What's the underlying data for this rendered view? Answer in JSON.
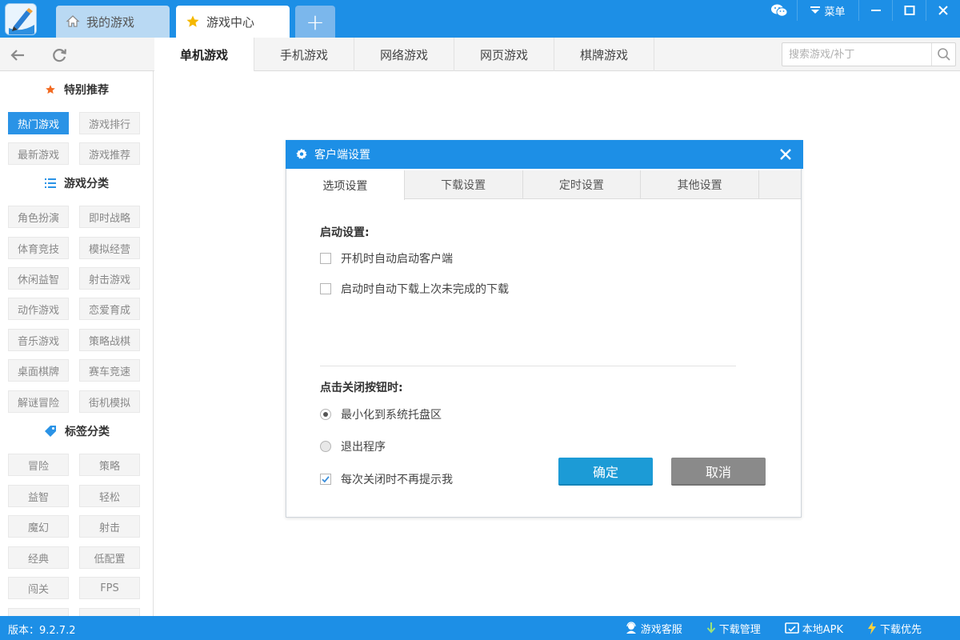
{
  "titlebar": {
    "tabs": [
      {
        "label": "我的游戏",
        "icon": "home-icon"
      },
      {
        "label": "游戏中心",
        "icon": "star-icon"
      }
    ],
    "add_tab_label": "+",
    "menu_label": "菜单"
  },
  "navbar": {
    "tabs": [
      "单机游戏",
      "手机游戏",
      "网络游戏",
      "网页游戏",
      "棋牌游戏"
    ],
    "active_tab": "单机游戏",
    "search_placeholder": "搜索游戏/补丁"
  },
  "sidebar": {
    "special_heading": "特别推荐",
    "special_items": [
      "热门游戏",
      "游戏排行",
      "最新游戏",
      "游戏推荐"
    ],
    "category_heading": "游戏分类",
    "category_items": [
      "角色扮演",
      "即时战略",
      "体育竞技",
      "模拟经营",
      "休闲益智",
      "射击游戏",
      "动作游戏",
      "恋爱育成",
      "音乐游戏",
      "策略战棋",
      "桌面棋牌",
      "赛车竞速",
      "解谜冒险",
      "街机模拟"
    ],
    "tag_heading": "标签分类",
    "tag_items": [
      "冒险",
      "策略",
      "益智",
      "轻松",
      "魔幻",
      "射击",
      "经典",
      "低配置",
      "闯关",
      "FPS"
    ]
  },
  "dialog": {
    "title": "客户端设置",
    "tabs": [
      "选项设置",
      "下载设置",
      "定时设置",
      "其他设置"
    ],
    "active_tab": "选项设置",
    "startup_title": "启动设置:",
    "opt_autostart": "开机时自动启动客户端",
    "opt_autostart_checked": false,
    "opt_resume": "启动时自动下载上次未完成的下载",
    "opt_resume_checked": false,
    "close_title": "点击关闭按钮时:",
    "radio_minimize": "最小化到系统托盘区",
    "radio_exit": "退出程序",
    "selected_close_action": "最小化到系统托盘区",
    "opt_no_prompt": "每次关闭时不再提示我",
    "opt_no_prompt_checked": true,
    "ok_label": "确定",
    "cancel_label": "取消"
  },
  "statusbar": {
    "version": "版本：9.2.7.2",
    "links": [
      {
        "label": "游戏客服",
        "icon": "customer-service-icon"
      },
      {
        "label": "下载管理",
        "icon": "download-arrow-icon"
      },
      {
        "label": "本地APK",
        "icon": "apk-icon"
      },
      {
        "label": "下载优先",
        "icon": "lightning-icon"
      }
    ]
  },
  "colors": {
    "brand_blue": "#1d8fe6",
    "ok_button": "#1c9bd6",
    "cancel_button": "#8a8a8a",
    "sidebar_active": "#2a93e6"
  }
}
